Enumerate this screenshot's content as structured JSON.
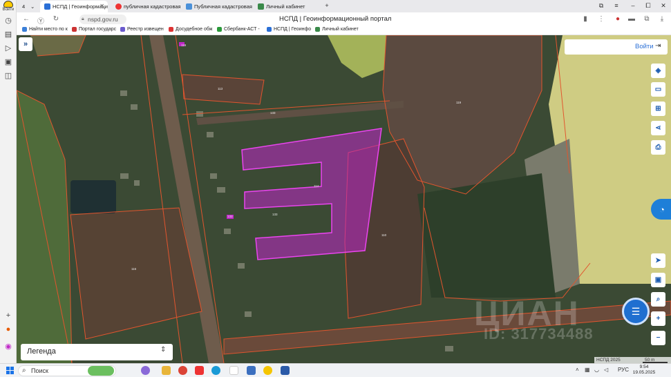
{
  "browser": {
    "left_rail": {
      "logo_text": "Войти"
    },
    "tabs": [
      {
        "label": "НСПД | Геоинформацио",
        "active": true
      },
      {
        "label": "публичная кадастровая",
        "active": false
      },
      {
        "label": "Публичная кадастровая к",
        "active": false
      },
      {
        "label": "Личный кабинет",
        "active": false
      }
    ],
    "tab_counter": "4",
    "url": "nspd.gov.ru",
    "page_title": "НСПД | Геоинформационный портал",
    "bookmarks": [
      "Найти место по к",
      "Портал государс",
      "Реестр извещен",
      "Досудебное обж",
      "Сбербанк-АСТ -",
      "НСПД | Геоинфо",
      "Личный кабинет"
    ]
  },
  "map": {
    "login_label": "Войти",
    "legend_label": "Легенда",
    "attribution": "НСПД 2025",
    "scale_label": "50 m",
    "watermark": "ЦИАН",
    "watermark_id": "ID: 317734488",
    "plot_labels": [
      "113",
      "133",
      "119",
      "114",
      "133",
      "110",
      "116",
      "133",
      "119"
    ],
    "colors": {
      "highlight_fill": "#c026c8",
      "boundary": "#e2552e",
      "accent": "#1a5bb0"
    }
  },
  "taskbar": {
    "search_placeholder": "Поиск",
    "language": "РУС",
    "time": "9:54",
    "date": "19.05.2025"
  }
}
